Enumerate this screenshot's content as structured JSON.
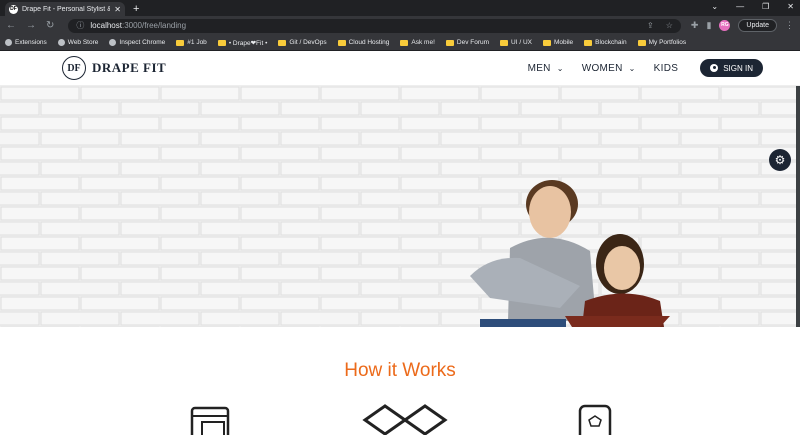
{
  "browser": {
    "tab_title": "Drape Fit - Personal Stylist & Per",
    "favicon": "DF",
    "url_host": "localhost",
    "url_path": ":3000/free/landing",
    "profile_initials": "RG",
    "update_label": "Update"
  },
  "bookmarks": [
    {
      "label": "Extensions",
      "icon": "puzzle-icon"
    },
    {
      "label": "Web Store",
      "icon": "store-icon"
    },
    {
      "label": "Inspect Chrome",
      "icon": "globe-icon"
    },
    {
      "label": "#1 Job",
      "icon": "folder-icon"
    },
    {
      "label": "• Drape❤Fit •",
      "icon": "folder-icon"
    },
    {
      "label": "Git / DevOps",
      "icon": "folder-icon"
    },
    {
      "label": "Cloud Hosting",
      "icon": "folder-icon"
    },
    {
      "label": "Ask me!",
      "icon": "folder-icon"
    },
    {
      "label": "Dev Forum",
      "icon": "folder-icon"
    },
    {
      "label": "UI / UX",
      "icon": "folder-icon"
    },
    {
      "label": "Mobile",
      "icon": "folder-icon"
    },
    {
      "label": "Blockchain",
      "icon": "folder-icon"
    },
    {
      "label": "My Portfolios",
      "icon": "folder-icon"
    }
  ],
  "site": {
    "logo_mark": "DF",
    "logo_text": "DRAPE FIT",
    "nav": [
      {
        "label": "MEN",
        "has_dropdown": true
      },
      {
        "label": "WOMEN",
        "has_dropdown": true
      },
      {
        "label": "KIDS",
        "has_dropdown": false
      }
    ],
    "signin_label": "SIGN IN",
    "brand_color": "#1c2533",
    "accent_color": "#ec6a1a"
  },
  "how": {
    "title": "How it Works"
  }
}
